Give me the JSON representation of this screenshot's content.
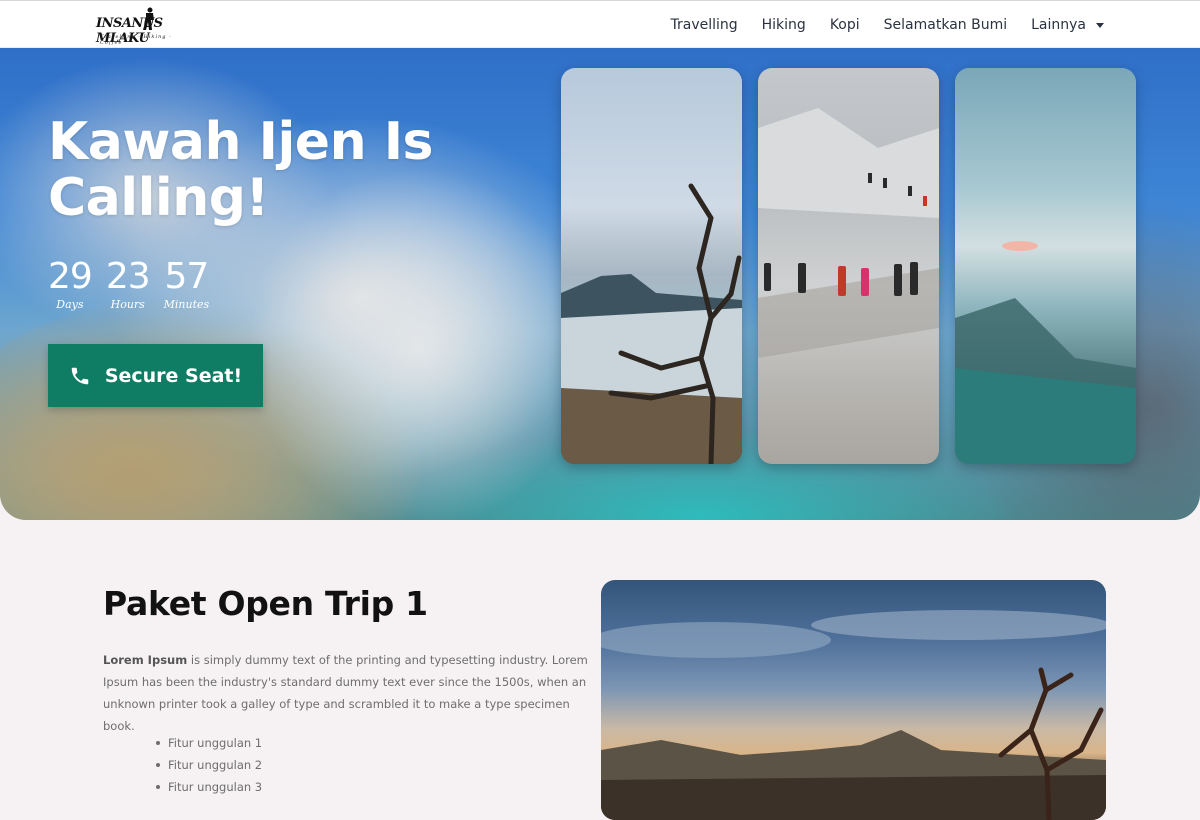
{
  "brand": {
    "name": "INSANUS MLAKU",
    "tagline": "Travelling · Hiking · Coffee"
  },
  "nav": {
    "items": [
      "Travelling",
      "Hiking",
      "Kopi",
      "Selamatkan Bumi",
      "Lainnya"
    ]
  },
  "hero": {
    "title": "Kawah Ijen Is Calling!",
    "countdown": {
      "days": "29",
      "hours": "23",
      "minutes": "57",
      "days_label": "Days",
      "hours_label": "Hours",
      "minutes_label": "Minutes"
    },
    "cta_label": "Secure Seat!",
    "cta_icon": "phone-icon"
  },
  "section": {
    "title": "Paket Open Trip 1",
    "desc_lead": "Lorem Ipsum",
    "desc_rest": " is simply dummy text of the printing and typesetting industry. Lorem Ipsum has been the industry's standard dummy text ever since the 1500s, when an unknown printer took a galley of type and scrambled it to make a type specimen book.",
    "features": [
      "Fitur unggulan 1",
      "Fitur unggulan 2",
      "Fitur unggulan 3"
    ]
  },
  "colors": {
    "accent": "#0e7d63",
    "page_bg": "#f6f2f3",
    "nav_text": "#2b3340"
  }
}
